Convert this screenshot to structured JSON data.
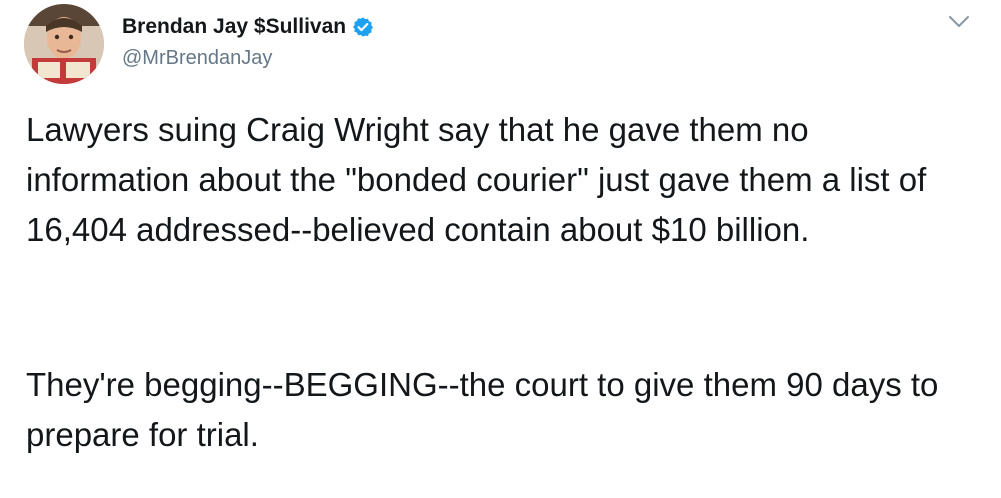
{
  "tweet": {
    "author_name": "Brendan Jay $Sullivan",
    "handle": "@MrBrendanJay",
    "verified": true,
    "paragraphs": [
      "Lawyers suing Craig Wright say that he gave them no information about the \"bonded courier\" just gave them a list of 16,404 addressed--believed contain about $10 billion.",
      "They're begging--BEGGING--the court to give them 90 days to prepare for trial."
    ]
  },
  "icons": {
    "avatar": "profile-photo",
    "verified": "verified-badge-icon",
    "menu": "chevron-down-icon"
  },
  "colors": {
    "text": "#14171a",
    "secondary": "#657786",
    "verified": "#1da1f2"
  }
}
